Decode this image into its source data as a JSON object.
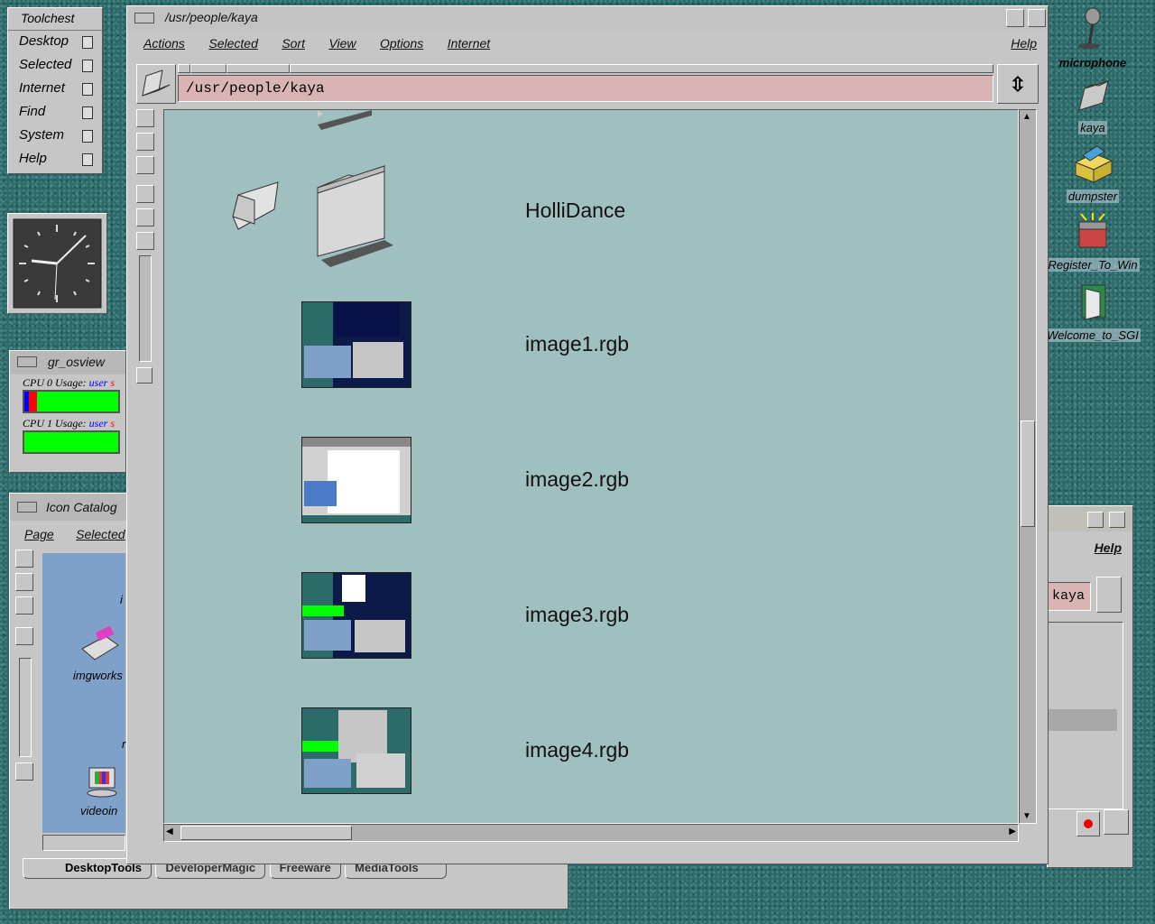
{
  "toolchest": {
    "title": "Toolchest",
    "items": [
      "Desktop",
      "Selected",
      "Internet",
      "Find",
      "System",
      "Help"
    ]
  },
  "osview": {
    "title": "gr_osview",
    "cpu0_label": "CPU 0 Usage:",
    "cpu1_label": "CPU 1 Usage:",
    "user_label": "user",
    "sys_label": "s"
  },
  "catalog": {
    "title": "Icon Catalog",
    "menu": [
      "Page",
      "Selected"
    ],
    "icons": [
      "imgworks",
      "videoin"
    ],
    "partial_labels": [
      "i",
      "r"
    ],
    "tabs": [
      "DesktopTools",
      "DeveloperMagic",
      "Freeware",
      "MediaTools"
    ]
  },
  "bg_window": {
    "help": "Help",
    "path_fragment": "kaya"
  },
  "main": {
    "title": "/usr/people/kaya",
    "menu": [
      "Actions",
      "Selected",
      "Sort",
      "View",
      "Options",
      "Internet"
    ],
    "help": "Help",
    "path": "/usr/people/kaya",
    "files": [
      {
        "name": "HolliDance",
        "kind": "folder"
      },
      {
        "name": "image1.rgb",
        "kind": "image"
      },
      {
        "name": "image2.rgb",
        "kind": "image"
      },
      {
        "name": "image3.rgb",
        "kind": "image"
      },
      {
        "name": "image4.rgb",
        "kind": "image"
      }
    ]
  },
  "desktop_icons": [
    "microphone",
    "kaya",
    "dumpster",
    "Register_To_Win",
    "Welcome_to_SGI"
  ],
  "colors": {
    "desktop": "#2d6b6b",
    "window_gray": "#c6c6c6",
    "view_bg": "#a0c0bf",
    "path_field": "#d8b4b4",
    "cpu_green": "#00ff00",
    "cpu_user": "#0000ff",
    "cpu_sys": "#ff0000"
  }
}
